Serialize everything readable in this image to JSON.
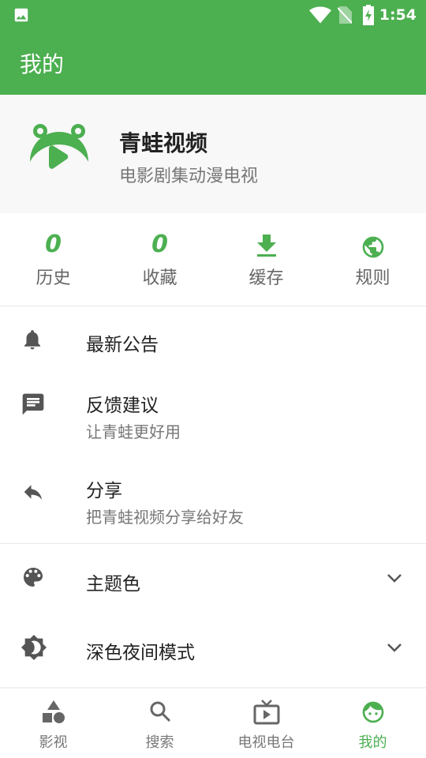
{
  "status_bar": {
    "time": "1:54",
    "icons": [
      "image-icon",
      "wifi-icon",
      "no-sim-icon",
      "battery-charging-icon"
    ]
  },
  "toolbar": {
    "title": "我的"
  },
  "profile": {
    "name": "青蛙视频",
    "subtitle": "电影剧集动漫电视"
  },
  "stats": [
    {
      "value": "0",
      "label": "历史"
    },
    {
      "value": "0",
      "label": "收藏"
    },
    {
      "icon": "download-icon",
      "label": "缓存"
    },
    {
      "icon": "globe-icon",
      "label": "规则"
    }
  ],
  "menu": [
    {
      "icon": "bell-icon",
      "title": "最新公告"
    },
    {
      "icon": "feedback-icon",
      "title": "反馈建议",
      "subtitle": "让青蛙更好用"
    },
    {
      "icon": "share-icon",
      "title": "分享",
      "subtitle": "把青蛙视频分享给好友"
    },
    {
      "icon": "palette-icon",
      "title": "主题色"
    },
    {
      "icon": "brightness-icon",
      "title": "深色夜间模式"
    }
  ],
  "nav": [
    {
      "label": "影视",
      "icon": "shapes-icon"
    },
    {
      "label": "搜索",
      "icon": "search-icon"
    },
    {
      "label": "电视电台",
      "icon": "tv-icon"
    },
    {
      "label": "我的",
      "icon": "face-icon",
      "active": true
    }
  ],
  "colors": {
    "primary": "#4caf50",
    "icon": "#555555"
  }
}
